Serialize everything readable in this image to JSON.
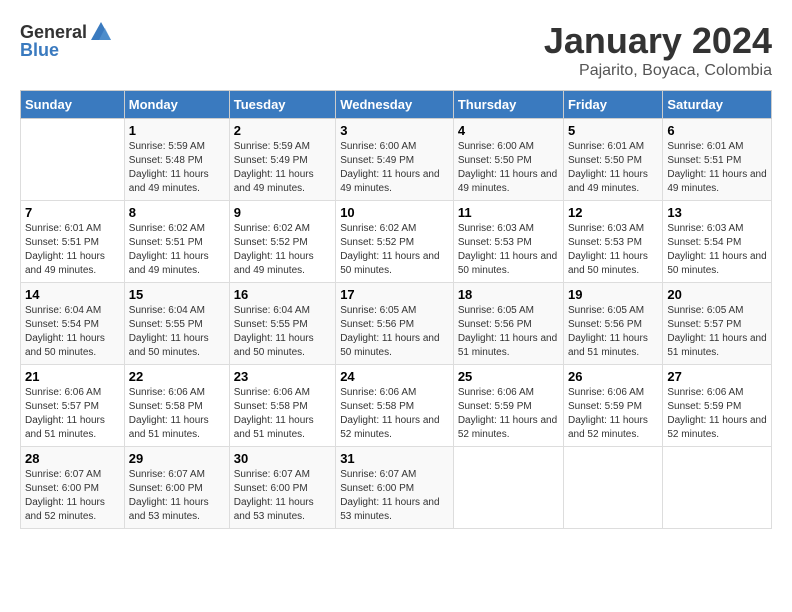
{
  "header": {
    "logo_general": "General",
    "logo_blue": "Blue",
    "title": "January 2024",
    "subtitle": "Pajarito, Boyaca, Colombia"
  },
  "weekdays": [
    "Sunday",
    "Monday",
    "Tuesday",
    "Wednesday",
    "Thursday",
    "Friday",
    "Saturday"
  ],
  "weeks": [
    [
      {
        "day": "",
        "sunrise": "",
        "sunset": "",
        "daylight": ""
      },
      {
        "day": "1",
        "sunrise": "Sunrise: 5:59 AM",
        "sunset": "Sunset: 5:48 PM",
        "daylight": "Daylight: 11 hours and 49 minutes."
      },
      {
        "day": "2",
        "sunrise": "Sunrise: 5:59 AM",
        "sunset": "Sunset: 5:49 PM",
        "daylight": "Daylight: 11 hours and 49 minutes."
      },
      {
        "day": "3",
        "sunrise": "Sunrise: 6:00 AM",
        "sunset": "Sunset: 5:49 PM",
        "daylight": "Daylight: 11 hours and 49 minutes."
      },
      {
        "day": "4",
        "sunrise": "Sunrise: 6:00 AM",
        "sunset": "Sunset: 5:50 PM",
        "daylight": "Daylight: 11 hours and 49 minutes."
      },
      {
        "day": "5",
        "sunrise": "Sunrise: 6:01 AM",
        "sunset": "Sunset: 5:50 PM",
        "daylight": "Daylight: 11 hours and 49 minutes."
      },
      {
        "day": "6",
        "sunrise": "Sunrise: 6:01 AM",
        "sunset": "Sunset: 5:51 PM",
        "daylight": "Daylight: 11 hours and 49 minutes."
      }
    ],
    [
      {
        "day": "7",
        "sunrise": "Sunrise: 6:01 AM",
        "sunset": "Sunset: 5:51 PM",
        "daylight": "Daylight: 11 hours and 49 minutes."
      },
      {
        "day": "8",
        "sunrise": "Sunrise: 6:02 AM",
        "sunset": "Sunset: 5:51 PM",
        "daylight": "Daylight: 11 hours and 49 minutes."
      },
      {
        "day": "9",
        "sunrise": "Sunrise: 6:02 AM",
        "sunset": "Sunset: 5:52 PM",
        "daylight": "Daylight: 11 hours and 49 minutes."
      },
      {
        "day": "10",
        "sunrise": "Sunrise: 6:02 AM",
        "sunset": "Sunset: 5:52 PM",
        "daylight": "Daylight: 11 hours and 50 minutes."
      },
      {
        "day": "11",
        "sunrise": "Sunrise: 6:03 AM",
        "sunset": "Sunset: 5:53 PM",
        "daylight": "Daylight: 11 hours and 50 minutes."
      },
      {
        "day": "12",
        "sunrise": "Sunrise: 6:03 AM",
        "sunset": "Sunset: 5:53 PM",
        "daylight": "Daylight: 11 hours and 50 minutes."
      },
      {
        "day": "13",
        "sunrise": "Sunrise: 6:03 AM",
        "sunset": "Sunset: 5:54 PM",
        "daylight": "Daylight: 11 hours and 50 minutes."
      }
    ],
    [
      {
        "day": "14",
        "sunrise": "Sunrise: 6:04 AM",
        "sunset": "Sunset: 5:54 PM",
        "daylight": "Daylight: 11 hours and 50 minutes."
      },
      {
        "day": "15",
        "sunrise": "Sunrise: 6:04 AM",
        "sunset": "Sunset: 5:55 PM",
        "daylight": "Daylight: 11 hours and 50 minutes."
      },
      {
        "day": "16",
        "sunrise": "Sunrise: 6:04 AM",
        "sunset": "Sunset: 5:55 PM",
        "daylight": "Daylight: 11 hours and 50 minutes."
      },
      {
        "day": "17",
        "sunrise": "Sunrise: 6:05 AM",
        "sunset": "Sunset: 5:56 PM",
        "daylight": "Daylight: 11 hours and 50 minutes."
      },
      {
        "day": "18",
        "sunrise": "Sunrise: 6:05 AM",
        "sunset": "Sunset: 5:56 PM",
        "daylight": "Daylight: 11 hours and 51 minutes."
      },
      {
        "day": "19",
        "sunrise": "Sunrise: 6:05 AM",
        "sunset": "Sunset: 5:56 PM",
        "daylight": "Daylight: 11 hours and 51 minutes."
      },
      {
        "day": "20",
        "sunrise": "Sunrise: 6:05 AM",
        "sunset": "Sunset: 5:57 PM",
        "daylight": "Daylight: 11 hours and 51 minutes."
      }
    ],
    [
      {
        "day": "21",
        "sunrise": "Sunrise: 6:06 AM",
        "sunset": "Sunset: 5:57 PM",
        "daylight": "Daylight: 11 hours and 51 minutes."
      },
      {
        "day": "22",
        "sunrise": "Sunrise: 6:06 AM",
        "sunset": "Sunset: 5:58 PM",
        "daylight": "Daylight: 11 hours and 51 minutes."
      },
      {
        "day": "23",
        "sunrise": "Sunrise: 6:06 AM",
        "sunset": "Sunset: 5:58 PM",
        "daylight": "Daylight: 11 hours and 51 minutes."
      },
      {
        "day": "24",
        "sunrise": "Sunrise: 6:06 AM",
        "sunset": "Sunset: 5:58 PM",
        "daylight": "Daylight: 11 hours and 52 minutes."
      },
      {
        "day": "25",
        "sunrise": "Sunrise: 6:06 AM",
        "sunset": "Sunset: 5:59 PM",
        "daylight": "Daylight: 11 hours and 52 minutes."
      },
      {
        "day": "26",
        "sunrise": "Sunrise: 6:06 AM",
        "sunset": "Sunset: 5:59 PM",
        "daylight": "Daylight: 11 hours and 52 minutes."
      },
      {
        "day": "27",
        "sunrise": "Sunrise: 6:06 AM",
        "sunset": "Sunset: 5:59 PM",
        "daylight": "Daylight: 11 hours and 52 minutes."
      }
    ],
    [
      {
        "day": "28",
        "sunrise": "Sunrise: 6:07 AM",
        "sunset": "Sunset: 6:00 PM",
        "daylight": "Daylight: 11 hours and 52 minutes."
      },
      {
        "day": "29",
        "sunrise": "Sunrise: 6:07 AM",
        "sunset": "Sunset: 6:00 PM",
        "daylight": "Daylight: 11 hours and 53 minutes."
      },
      {
        "day": "30",
        "sunrise": "Sunrise: 6:07 AM",
        "sunset": "Sunset: 6:00 PM",
        "daylight": "Daylight: 11 hours and 53 minutes."
      },
      {
        "day": "31",
        "sunrise": "Sunrise: 6:07 AM",
        "sunset": "Sunset: 6:00 PM",
        "daylight": "Daylight: 11 hours and 53 minutes."
      },
      {
        "day": "",
        "sunrise": "",
        "sunset": "",
        "daylight": ""
      },
      {
        "day": "",
        "sunrise": "",
        "sunset": "",
        "daylight": ""
      },
      {
        "day": "",
        "sunrise": "",
        "sunset": "",
        "daylight": ""
      }
    ]
  ]
}
